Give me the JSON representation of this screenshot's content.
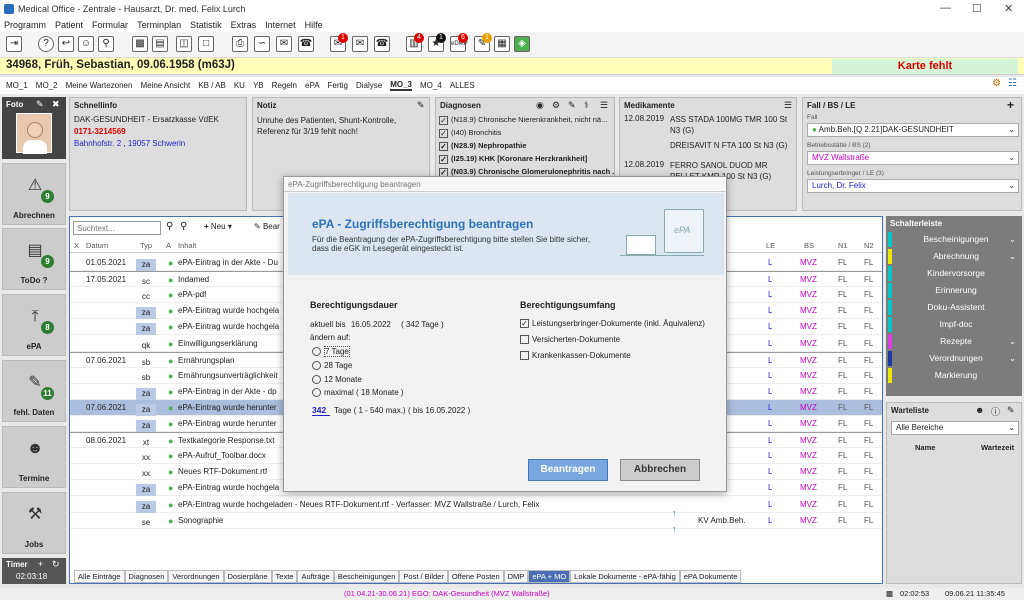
{
  "window": {
    "title": "Medical Office - Zentrale - Hausarzt, Dr. med. Felix Lurch"
  },
  "menu": [
    "Programm",
    "Patient",
    "Formular",
    "Terminplan",
    "Statistik",
    "Extras",
    "Internet",
    "Hilfe"
  ],
  "toolbar": {
    "badges": [
      "1",
      "4",
      "1",
      "6",
      "1"
    ],
    "edmp_label": "eDMP"
  },
  "patient": {
    "header": "34968, Früh, Sebastian, 09.06.1958 (m63J)",
    "karte": "Karte fehlt"
  },
  "tabs": [
    "MO_1",
    "MO_2",
    "Meine Wartezonen",
    "Meine Ansicht",
    "KB / AB",
    "KU",
    "YB",
    "Regeln",
    "ePA",
    "Fertig",
    "Dialyse",
    "MO_3",
    "MO_4",
    "ALLES"
  ],
  "active_tab": "MO_3",
  "nav": [
    {
      "label": "Abrechnen",
      "count": "9"
    },
    {
      "label": "ToDo ?",
      "count": "9"
    },
    {
      "label": "ePA",
      "count": "8"
    },
    {
      "label": "fehl. Daten",
      "count": "11"
    },
    {
      "label": "Termine",
      "count": ""
    },
    {
      "label": "Jobs",
      "count": ""
    }
  ],
  "foto_label": "Foto",
  "timer": {
    "label": "Timer",
    "value": "02:03:18"
  },
  "schnellinfo": {
    "title": "Schnellinfo",
    "insurer": "DAK-GESUNDHEIT - Ersatzkasse VdEK",
    "phone": "0171-3214569",
    "address": "Bahnhofstr. 2 , 19057 Schwerin"
  },
  "notiz": {
    "title": "Notiz",
    "text": "Unruhe des Patienten, Shunt-Kontrolle, Referenz für 3/19 fehlt noch!"
  },
  "diagnosen": {
    "title": "Diagnosen",
    "items": [
      {
        "text": "(N18.9) Chronische Nierenkrankheit, nicht nä...",
        "bold": false
      },
      {
        "text": "(I40) Bronchitis",
        "bold": false
      },
      {
        "text": "(N28.9) Nephropathie",
        "bold": true
      },
      {
        "text": "(I25.19) KHK [Koronare Herzkrankheit]",
        "bold": true
      },
      {
        "text": "(N03.9) Chronische Glomerulonephritis nach ...",
        "bold": true
      }
    ]
  },
  "medikamente": {
    "title": "Medikamente",
    "items": [
      {
        "date": "12.08.2019",
        "text": "ASS STADA 100MG TMR 100 St N3 (G)"
      },
      {
        "date": "",
        "text": "DREISAVIT N FTA 100 St N3 (G)"
      },
      {
        "date": "12.08.2019",
        "text": "FERRO SANOL DUOD MR PELLET KMR 100 St N3 (G)"
      }
    ]
  },
  "fall": {
    "title": "Fall / BS / LE",
    "fall_label": "Fall",
    "fall_value": "Amb.Beh.[Q 2.21]DAK-GESUNDHEIT",
    "bs_label": "Betriebsstätte / BS (2)",
    "bs_value": "MVZ Wallstraße",
    "le_label": "Leistungserbringer / LE (3)",
    "le_value": "Lurch, Dr. Felix"
  },
  "search": {
    "placeholder": "Suchtext...",
    "neu": "Neu",
    "bear": "Bear"
  },
  "columns": {
    "x": "X",
    "datum": "Datum",
    "typ": "Typ",
    "a": "A",
    "inhalt": "Inhalt",
    "le": "LE",
    "bs": "BS",
    "n1": "N1",
    "n2": "N2"
  },
  "rows": [
    {
      "date": "01.05.2021",
      "typ": "za",
      "hl": true,
      "text": "ePA-Eintrag in der Akte - Du",
      "right": "",
      "le": "L",
      "bs": "MVZ",
      "n1": "FL",
      "n2": "FL",
      "sel": false,
      "sep": false
    },
    {
      "date": "17.05.2021",
      "typ": "sc",
      "hl": false,
      "text": "Indamed",
      "right": "b.Beh.",
      "le": "L",
      "bs": "MVZ",
      "n1": "FL",
      "n2": "FL",
      "sel": false,
      "sep": true
    },
    {
      "date": "",
      "typ": "cc",
      "hl": false,
      "text": "ePA-pdf",
      "right": "b.Beh.",
      "le": "L",
      "bs": "MVZ",
      "n1": "FL",
      "n2": "FL",
      "sel": false,
      "sep": false
    },
    {
      "date": "",
      "typ": "za",
      "hl": true,
      "text": "ePA-Eintrag wurde hochgela",
      "right": "",
      "le": "L",
      "bs": "MVZ",
      "n1": "FL",
      "n2": "FL",
      "sel": false,
      "sep": false
    },
    {
      "date": "",
      "typ": "za",
      "hl": true,
      "text": "ePA-Eintrag wurde hochgela",
      "right": "",
      "le": "L",
      "bs": "MVZ",
      "n1": "FL",
      "n2": "FL",
      "sel": false,
      "sep": false
    },
    {
      "date": "",
      "typ": "qk",
      "hl": false,
      "text": "Einwilligungserklärung",
      "right": "b.Beh.",
      "le": "L",
      "bs": "MVZ",
      "n1": "FL",
      "n2": "FL",
      "sel": false,
      "sep": false
    },
    {
      "date": "07.06.2021",
      "typ": "sb",
      "hl": false,
      "text": "Ernährungsplan",
      "right": "b.Beh.",
      "le": "L",
      "bs": "MVZ",
      "n1": "FL",
      "n2": "FL",
      "sel": false,
      "sep": true
    },
    {
      "date": "",
      "typ": "sb",
      "hl": false,
      "text": "Ernährungsunverträglichkeit",
      "right": "b.Beh.",
      "le": "L",
      "bs": "MVZ",
      "n1": "FL",
      "n2": "FL",
      "sel": false,
      "sep": false
    },
    {
      "date": "",
      "typ": "za",
      "hl": true,
      "text": "ePA-Eintrag in der Akte - dp",
      "right": "",
      "le": "L",
      "bs": "MVZ",
      "n1": "FL",
      "n2": "FL",
      "sel": false,
      "sep": false
    },
    {
      "date": "07.06.2021",
      "typ": "za",
      "hl": true,
      "text": "ePA-Eintrag wurde herunter",
      "right": "",
      "le": "L",
      "bs": "MVZ",
      "n1": "FL",
      "n2": "FL",
      "sel": true,
      "sep": false
    },
    {
      "date": "",
      "typ": "za",
      "hl": true,
      "text": "ePA-Eintrag wurde herunter",
      "right": "",
      "le": "L",
      "bs": "MVZ",
      "n1": "FL",
      "n2": "FL",
      "sel": false,
      "sep": false
    },
    {
      "date": "08.06.2021",
      "typ": "xt",
      "hl": false,
      "text": "Textkategorie Response.txt",
      "right": "b.Beh.",
      "le": "L",
      "bs": "MVZ",
      "n1": "FL",
      "n2": "FL",
      "sel": false,
      "sep": true
    },
    {
      "date": "",
      "typ": "xx",
      "hl": false,
      "text": "ePA-Aufruf_Toolbar.docx",
      "right": "b.Beh.",
      "le": "L",
      "bs": "MVZ",
      "n1": "FL",
      "n2": "FL",
      "sel": false,
      "sep": false
    },
    {
      "date": "",
      "typ": "xx",
      "hl": false,
      "text": "Neues RTF-Dokument.rtf",
      "right": "b.Beh.",
      "le": "L",
      "bs": "MVZ",
      "n1": "FL",
      "n2": "FL",
      "sel": false,
      "sep": false
    },
    {
      "date": "",
      "typ": "za",
      "hl": true,
      "text": "ePA-Eintrag wurde hochgela",
      "right": "",
      "le": "L",
      "bs": "MVZ",
      "n1": "FL",
      "n2": "FL",
      "sel": false,
      "sep": false
    },
    {
      "date": "",
      "typ": "za",
      "hl": true,
      "text": "ePA-Eintrag wurde hochgeladen - Neues RTF-Dokument.rtf  -  Verfasser: MVZ Wallstraße / Lurch, Felix",
      "right": "",
      "le": "L",
      "bs": "MVZ",
      "n1": "FL",
      "n2": "FL",
      "sel": false,
      "sep": false
    },
    {
      "date": "",
      "typ": "se",
      "hl": false,
      "text": "Sonographie",
      "right": "KV Amb.Beh.",
      "le": "L",
      "bs": "MVZ",
      "n1": "FL",
      "n2": "FL",
      "sel": false,
      "sep": false
    }
  ],
  "bottom_tabs": [
    "Alle Einträge",
    "Diagnosen",
    "Verordnungen",
    "Dosierpläne",
    "Texte",
    "Aufträge",
    "Bescheinigungen",
    "Post / Bilder",
    "Offene Posten",
    "DMP",
    "ePA + MO",
    "Lokale Dokumente - ePA-fähig",
    "ePA Dokumente"
  ],
  "bottom_active": "ePA + MO",
  "schalterleiste": {
    "title": "Schalterleiste",
    "items": [
      {
        "label": "Bescheinigungen",
        "color": "#00c8c8",
        "chev": true
      },
      {
        "label": "Abrechnung",
        "color": "#e8e800",
        "chev": true
      },
      {
        "label": "Kindervorsorge",
        "color": "#00c8c8",
        "chev": false
      },
      {
        "label": "Erinnerung",
        "color": "#00c8c8",
        "chev": false
      },
      {
        "label": "Doku-Assistent",
        "color": "#00c8c8",
        "chev": false
      },
      {
        "label": "Impf-doc",
        "color": "#00c8c8",
        "chev": false
      },
      {
        "label": "Rezepte",
        "color": "#e040e0",
        "chev": true
      },
      {
        "label": "Verordnungen",
        "color": "#1a3aa0",
        "chev": true
      },
      {
        "label": "Markierung",
        "color": "#e8e800",
        "chev": false
      }
    ]
  },
  "warteliste": {
    "title": "Warteliste",
    "filter": "Alle Bereiche",
    "col_name": "Name",
    "col_wait": "Wartezeit"
  },
  "status": {
    "center": "(01.04.21-30.06.21) EGO: DAK-Gesundheit (MVZ Wallstraße)",
    "time1": "02:02:53",
    "datetime": "09.06.21 11:35:45"
  },
  "modal": {
    "window_title": "ePA-Zugriffsberechtigung beantragen",
    "heading": "ePA - Zugriffsberechtigung beantragen",
    "intro": "Für die Beantragung der ePA-Zugriffsberechtigung bitte stellen Sie bitte sicher, dass die eGK im Lesegerät eingesteckt ist.",
    "art_label": "ePA",
    "dauer_title": "Berechtigungsdauer",
    "aktuell_prefix": "aktuell bis",
    "aktuell_date": "16.05.2022",
    "aktuell_days": "( 342 Tage )",
    "aendern": "ändern auf:",
    "options": [
      "7 Tage",
      "28 Tage",
      "12 Monate",
      "maximal ( 18 Monate )"
    ],
    "days_value": "342",
    "days_suffix": "Tage ( 1 - 540 max.)",
    "days_until": "( bis 16.05.2022 )",
    "umfang_title": "Berechtigungsumfang",
    "checks": [
      {
        "label": "Leistungserbringer-Dokumente  (inkl. Äquivalenz)",
        "checked": true
      },
      {
        "label": "Versicherten-Dokumente",
        "checked": false
      },
      {
        "label": "Krankenkassen-Dokumente",
        "checked": false
      }
    ],
    "btn_ok": "Beantragen",
    "btn_cancel": "Abbrechen"
  }
}
